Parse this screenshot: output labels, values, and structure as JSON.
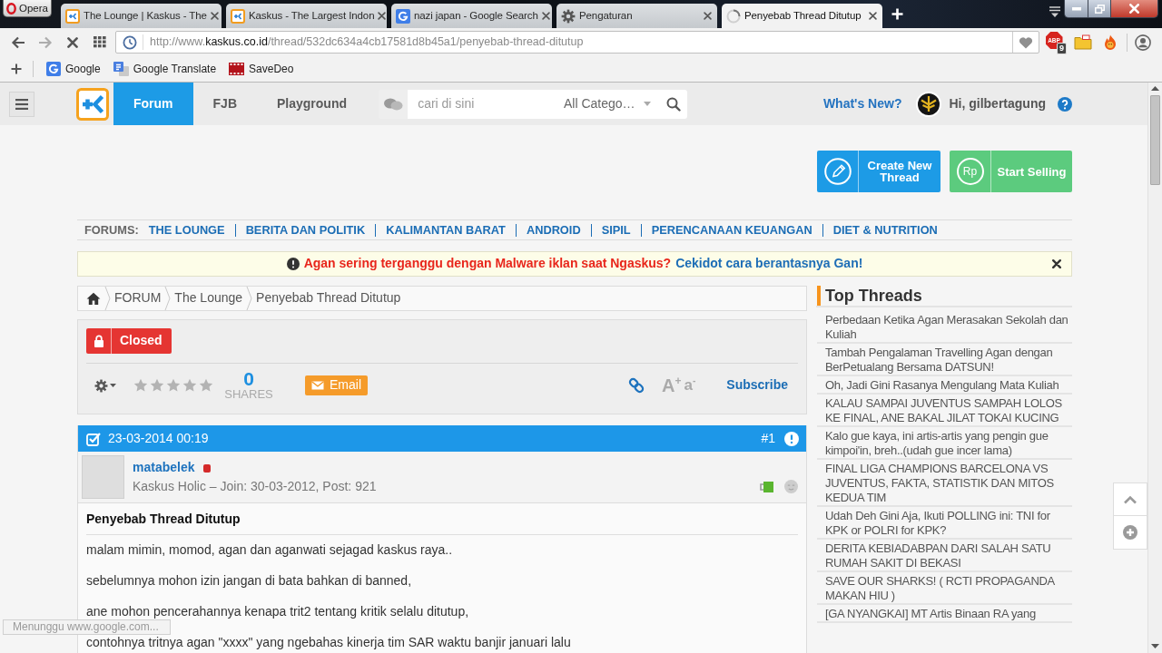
{
  "browser": {
    "menu_label": "Opera",
    "tabs": [
      {
        "title": "The Lounge | Kaskus - The",
        "kind": "kaskus",
        "selected": false
      },
      {
        "title": "Kaskus - The Largest Indon",
        "kind": "kaskus",
        "selected": false
      },
      {
        "title": "nazi japan - Google Search",
        "kind": "google",
        "selected": false
      },
      {
        "title": "Pengaturan",
        "kind": "settings",
        "selected": false
      },
      {
        "title": "Penyebab Thread Ditutup",
        "kind": "loading",
        "selected": true
      }
    ],
    "address": [
      {
        "text": "http://www.",
        "emphasis": false
      },
      {
        "text": "kaskus.co.id",
        "emphasis": true
      },
      {
        "text": "/thread/532dc634a4cb17581d8b45a1/penyebab-thread-ditutup",
        "emphasis": false
      }
    ],
    "extensions": {
      "adblock_label": "ABP",
      "adblock_count": "9"
    },
    "bookmarks": [
      {
        "label": "Google",
        "kind": "google"
      },
      {
        "label": "Google Translate",
        "kind": "translate"
      },
      {
        "label": "SaveDeo",
        "kind": "film"
      }
    ],
    "status_text": "Menunggu www.google.com..."
  },
  "site_header": {
    "nav": [
      {
        "label": "Forum",
        "selected": true
      },
      {
        "label": "FJB",
        "selected": false
      },
      {
        "label": "Playground",
        "selected": false
      }
    ],
    "search": {
      "placeholder": "cari di sini",
      "category": "All Catego…"
    },
    "whats_new": "What's New?",
    "greeting": "Hi, gilbertagung"
  },
  "actions": [
    {
      "label": "Create New Thread",
      "kind": "create"
    },
    {
      "label": "Start Selling",
      "kind": "sell",
      "icon_text": "Rp"
    }
  ],
  "forums_bar": {
    "label": "FORUMS:",
    "links": [
      "THE LOUNGE",
      "BERITA DAN POLITIK",
      "KALIMANTAN BARAT",
      "ANDROID",
      "SIPIL",
      "PERENCANAAN KEUANGAN",
      "DIET & NUTRITION"
    ]
  },
  "alert": {
    "message": "Agan sering terganggu dengan Malware iklan saat Ngaskus?",
    "link": "Cekidot cara berantasnya Gan!"
  },
  "breadcrumb": [
    "FORUM",
    "The Lounge",
    "Penyebab Thread Ditutup"
  ],
  "thread_tools": {
    "status": "Closed",
    "stars": 0,
    "shares_count": "0",
    "shares_label": "SHARES",
    "email": "Email",
    "font_larger": "A$^{+}$",
    "font_smaller": "a$^{-}$",
    "subscribe": "Subscribe"
  },
  "post": {
    "date": "23-03-2014 00:19",
    "number": "#1",
    "author": {
      "username": "matabelek",
      "online": false,
      "meta": "Kaskus Holic – Join: 30-03-2012, Post:",
      "post_count": "921"
    },
    "title": "Penyebab Thread Ditutup",
    "paragraphs": [
      "malam mimin, momod, agan dan aganwati sejagad kaskus raya..",
      "sebelumnya mohon izin jangan di bata bahkan di banned,",
      "ane mohon pencerahannya kenapa trit2 tentang kritik selalu ditutup,",
      "contohnya tritnya agan \"xxxx\" yang ngebahas kinerja tim SAR waktu banjir januari lalu"
    ]
  },
  "top_threads": {
    "title": "Top Threads",
    "items": [
      "Perbedaan Ketika Agan Merasakan Sekolah dan Kuliah",
      "Tambah Pengalaman Travelling Agan dengan BerPetualang Bersama DATSUN!",
      "Oh, Jadi Gini Rasanya Mengulang Mata Kuliah",
      "KALAU SAMPAI JUVENTUS SAMPAH LOLOS KE FINAL, ANE BAKAL JILAT TOKAI KUCING",
      "Kalo gue kaya, ini artis-artis yang pengin gue kimpoi'in, breh..(udah gue incer lama)",
      "FINAL LIGA CHAMPIONS BARCELONA VS JUVENTUS, FAKTA, STATISTIK DAN MITOS KEDUA TIM",
      "Udah Deh Gini Aja, Ikuti POLLING ini: TNI for KPK or POLRI for KPK?",
      "DERITA KEBIADABPAN DARI SALAH SATU RUMAH SAKIT DI BEKASI",
      "SAVE OUR SHARKS! ( RCTI PROPAGANDA MAKAN HIU )",
      "[GA NYANGKAI] MT Artis Binaan RA yang"
    ]
  }
}
